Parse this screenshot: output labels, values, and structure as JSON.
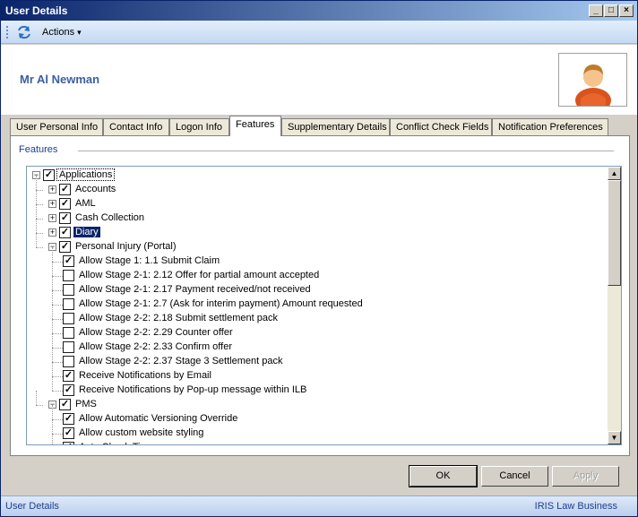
{
  "window": {
    "title": "User Details"
  },
  "toolbar": {
    "actions_label": "Actions",
    "actions_caret": "▾"
  },
  "header": {
    "user_name": "Mr Al Newman"
  },
  "tabs": [
    {
      "label": "User Personal Info",
      "active": false
    },
    {
      "label": "Contact Info",
      "active": false
    },
    {
      "label": "Logon Info",
      "active": false
    },
    {
      "label": "Features",
      "active": true
    },
    {
      "label": "Supplementary Details",
      "active": false
    },
    {
      "label": "Conflict Check Fields",
      "active": false
    },
    {
      "label": "Notification Preferences",
      "active": false
    }
  ],
  "features": {
    "group_label": "Features",
    "tree": [
      {
        "label": "Applications",
        "level": 0,
        "expander": "−",
        "checked": true,
        "focus": true
      },
      {
        "label": "Accounts",
        "level": 1,
        "expander": "+",
        "checked": true
      },
      {
        "label": "AML",
        "level": 1,
        "expander": "+",
        "checked": true
      },
      {
        "label": "Cash Collection",
        "level": 1,
        "expander": "+",
        "checked": true
      },
      {
        "label": "Diary",
        "level": 1,
        "expander": "+",
        "checked": true,
        "selected": true
      },
      {
        "label": "Personal Injury (Portal)",
        "level": 1,
        "expander": "−",
        "checked": true
      },
      {
        "label": "Allow Stage 1: 1.1 Submit Claim",
        "level": 2,
        "checked": true
      },
      {
        "label": "Allow Stage 2-1: 2.12 Offer for partial amount accepted",
        "level": 2,
        "checked": false
      },
      {
        "label": "Allow Stage 2-1: 2.17 Payment received/not received",
        "level": 2,
        "checked": false
      },
      {
        "label": "Allow Stage 2-1: 2.7 (Ask for interim payment) Amount requested",
        "level": 2,
        "checked": false
      },
      {
        "label": "Allow Stage 2-2: 2.18 Submit settlement pack",
        "level": 2,
        "checked": false
      },
      {
        "label": "Allow Stage 2-2: 2.29 Counter offer",
        "level": 2,
        "checked": false
      },
      {
        "label": "Allow Stage 2-2: 2.33 Confirm offer",
        "level": 2,
        "checked": false
      },
      {
        "label": "Allow Stage 2-2: 2.37 Stage 3 Settlement pack",
        "level": 2,
        "checked": false
      },
      {
        "label": "Receive Notifications by Email",
        "level": 2,
        "checked": true
      },
      {
        "label": "Receive Notifications by Pop-up message within ILB",
        "level": 2,
        "checked": true
      },
      {
        "label": "PMS",
        "level": 1,
        "expander": "−",
        "checked": true
      },
      {
        "label": "Allow Automatic Versioning Override",
        "level": 2,
        "checked": true
      },
      {
        "label": "Allow custom website styling",
        "level": 2,
        "checked": true
      },
      {
        "label": "Auto Check Time",
        "level": 2,
        "checked": true
      }
    ]
  },
  "buttons": {
    "ok": "OK",
    "cancel": "Cancel",
    "apply": "Apply"
  },
  "statusbar": {
    "left": "User Details",
    "right": "IRIS Law Business"
  },
  "colors": {
    "title_start": "#0a246a",
    "accent": "#3b5f9e",
    "selection": "#0a246a"
  },
  "icons": {
    "refresh": "refresh-icon",
    "avatar": "user-avatar-icon"
  }
}
